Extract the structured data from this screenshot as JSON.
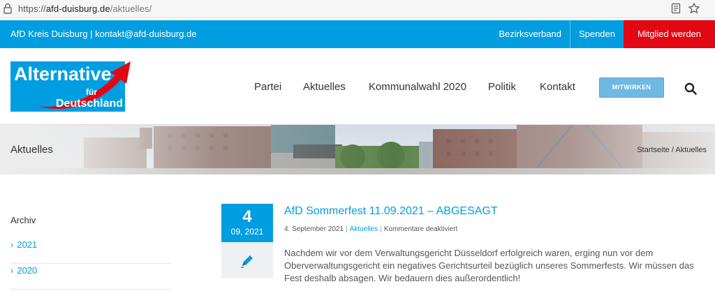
{
  "browser": {
    "url_scheme": "https://",
    "url_host": "afd-duisburg.de",
    "url_path": "/aktuelles/",
    "icons": [
      "lock-icon",
      "reader-view-icon",
      "bookmark-star-icon"
    ]
  },
  "topbar": {
    "contact_text": "AfD Kreis Duisburg | kontakt@afd-duisburg.de",
    "links": [
      {
        "label": "Bezirksverband"
      },
      {
        "label": "Spenden"
      },
      {
        "label": "Mitglied werden"
      }
    ],
    "colors": {
      "bar": "#009ee0",
      "cta": "#e30613"
    }
  },
  "logo": {
    "line1": "Alternative",
    "line2": "für",
    "line3": "Deutschland",
    "colors": {
      "blue": "#009ee0",
      "red": "#e30613"
    }
  },
  "nav": {
    "items": [
      "Partei",
      "Aktuelles",
      "Kommunalwahl 2020",
      "Politik",
      "Kontakt"
    ],
    "cta_label": "MITWIRKEN",
    "search_icon": "search-icon"
  },
  "banner": {
    "title": "Aktuelles",
    "breadcrumb": [
      "Startseite",
      "Aktuelles"
    ],
    "breadcrumb_separator": "/"
  },
  "sidebar": {
    "heading": "Archiv",
    "items": [
      {
        "label": "2021"
      },
      {
        "label": "2020"
      }
    ]
  },
  "post": {
    "day": "4",
    "month_year": "09, 2021",
    "format_icon": "pen-icon",
    "title": "AfD Sommerfest 11.09.2021 – ABGESAGT",
    "date": "4. September 2021",
    "category": "Aktuelles",
    "comments": "Kommentare deaktiviert",
    "excerpt": "Nachdem wir vor dem Verwaltungsgericht Düsseldorf erfolgreich waren, erging nun vor dem Oberverwaltungsgericht ein negatives Gerichtsurteil bezüglich unseres Sommerfests. Wir müssen das Fest deshalb absagen. Wir bedauern dies außerordentlich!"
  }
}
